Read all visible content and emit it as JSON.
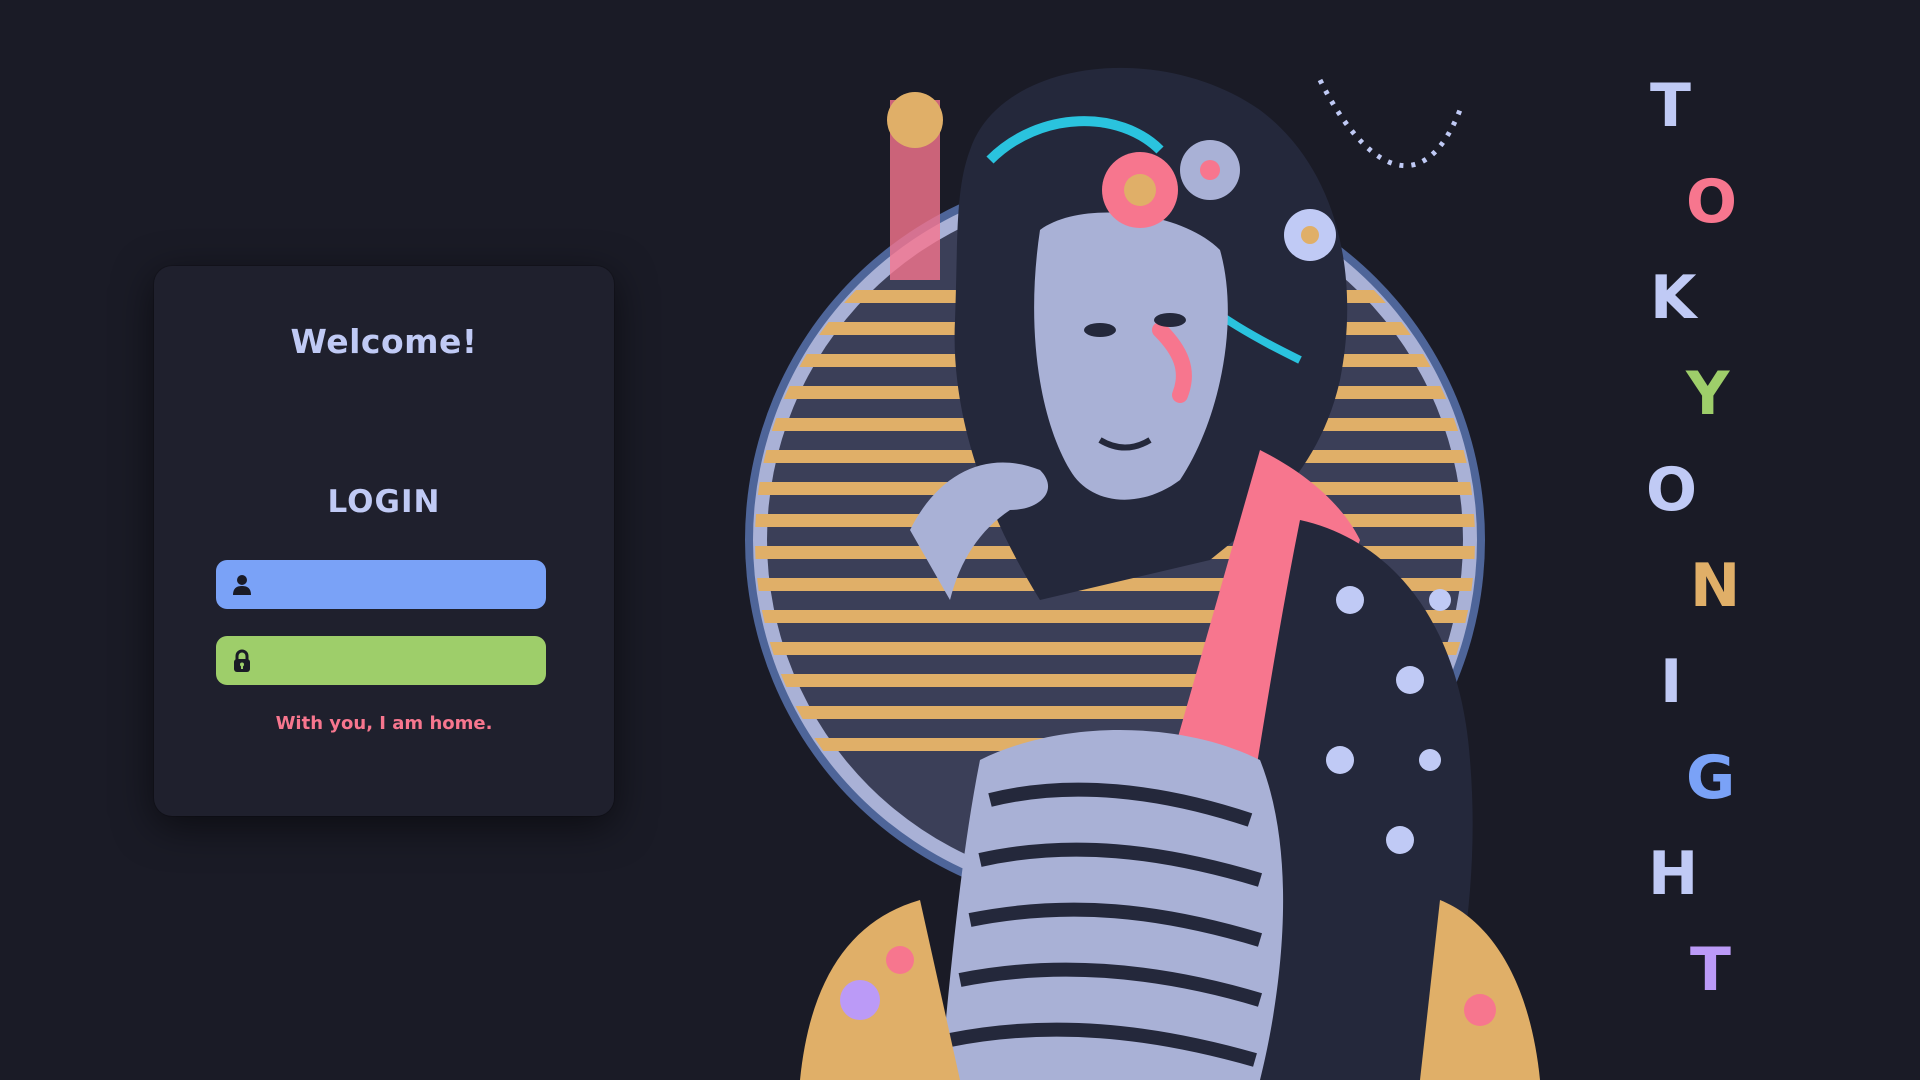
{
  "login": {
    "welcome": "Welcome!",
    "heading": "LOGIN",
    "username_value": "",
    "password_value": "",
    "tagline": "With you, I am home."
  },
  "title_letters": [
    {
      "char": "T",
      "color": "#c0caf5"
    },
    {
      "char": "O",
      "color": "#f7768e"
    },
    {
      "char": "K",
      "color": "#c0caf5"
    },
    {
      "char": "Y",
      "color": "#9ece6a"
    },
    {
      "char": "O",
      "color": "#c0caf5"
    },
    {
      "char": "N",
      "color": "#e0af68"
    },
    {
      "char": "I",
      "color": "#c0caf5"
    },
    {
      "char": "G",
      "color": "#7aa2f7"
    },
    {
      "char": "H",
      "color": "#c0caf5"
    },
    {
      "char": "T",
      "color": "#bb9af7"
    }
  ],
  "icons": {
    "user": "user-icon",
    "lock": "lock-icon"
  },
  "colors": {
    "background": "#1a1b26",
    "card": "#1f202d",
    "text": "#c0caf5",
    "blue": "#7aa2f7",
    "green": "#9ece6a",
    "red": "#f7768e",
    "yellow": "#e0af68",
    "purple": "#bb9af7"
  }
}
